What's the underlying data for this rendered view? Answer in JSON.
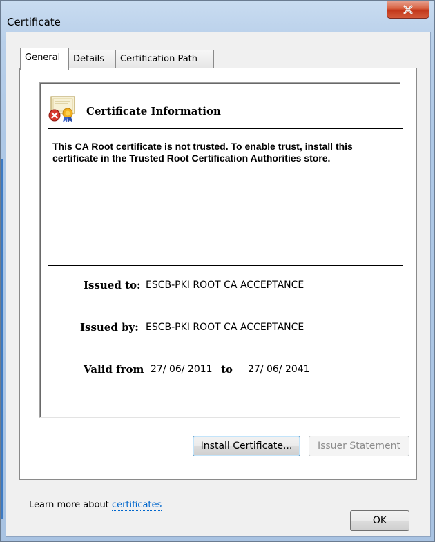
{
  "window": {
    "title": "Certificate",
    "close_glyph": "X"
  },
  "tabs": [
    {
      "label": "General",
      "active": true
    },
    {
      "label": "Details",
      "active": false
    },
    {
      "label": "Certification Path",
      "active": false
    }
  ],
  "general": {
    "heading": "Certificate Information",
    "warning": "This CA Root certificate is not trusted. To enable trust, install this certificate in the Trusted Root Certification Authorities store.",
    "issued_to_label": "Issued to:",
    "issued_to_value": "ESCB-PKI ROOT CA ACCEPTANCE",
    "issued_by_label": "Issued by:",
    "issued_by_value": "ESCB-PKI ROOT CA ACCEPTANCE",
    "valid_from_label": "Valid from",
    "valid_from_value": "27/ 06/ 2011",
    "valid_to_label": "to",
    "valid_to_value": "27/ 06/ 2041",
    "install_button": "Install Certificate...",
    "issuer_statement_button": "Issuer Statement",
    "learn_more_text": "Learn more about",
    "learn_more_link": "certificates"
  },
  "footer": {
    "ok_button": "OK"
  },
  "icons": {
    "certificate": "certificate-error-icon",
    "close": "close-icon"
  },
  "colors": {
    "link": "#0066cc",
    "close_button": "#c94a2a",
    "window_frame": "#b9d1ea"
  }
}
